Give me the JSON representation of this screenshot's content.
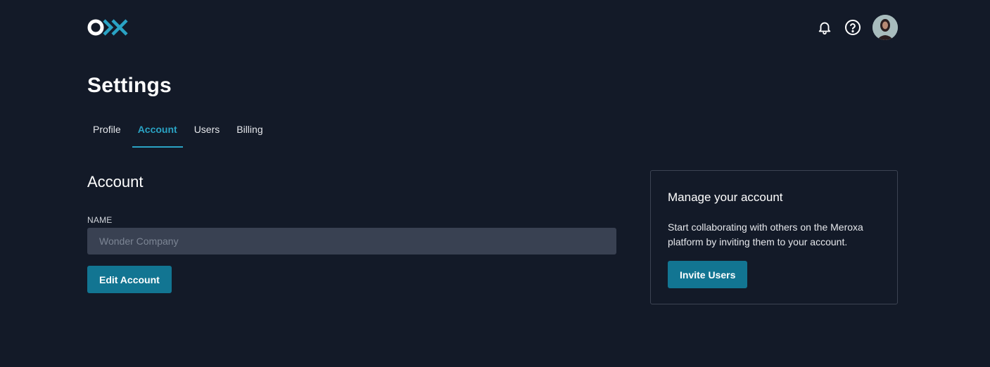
{
  "header": {
    "logo_icon": "ox-logo-icon",
    "actions": [
      {
        "icon": "bell-icon"
      },
      {
        "icon": "help-circle-icon"
      },
      {
        "icon": "avatar"
      }
    ]
  },
  "page_title": "Settings",
  "tabs": [
    {
      "label": "Profile",
      "active": false
    },
    {
      "label": "Account",
      "active": true
    },
    {
      "label": "Users",
      "active": false
    },
    {
      "label": "Billing",
      "active": false
    }
  ],
  "account": {
    "title": "Account",
    "name_label": "NAME",
    "name_value": "",
    "name_placeholder": "Wonder Company",
    "edit_button": "Edit Account"
  },
  "manage_card": {
    "title": "Manage your account",
    "text": "Start collaborating with others on the Meroxa platform by inviting them to your account.",
    "invite_button": "Invite Users"
  },
  "colors": {
    "background": "#131a28",
    "accent": "#2aa3c4",
    "button": "#127592",
    "input_bg": "#394152"
  }
}
